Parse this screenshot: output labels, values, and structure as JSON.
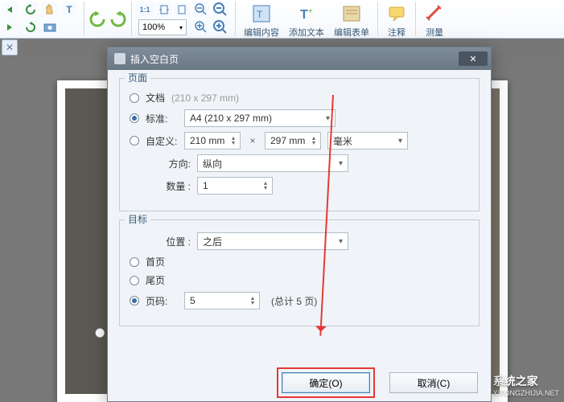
{
  "toolbar": {
    "zoom_1_1": "1:1",
    "zoom_percent": "100%",
    "edit_content": "编辑内容",
    "add_text": "添加文本",
    "edit_form": "编辑表单",
    "annotate": "注释",
    "measure": "测量"
  },
  "dialog": {
    "title": "插入空白页",
    "page_group": "页面",
    "document_label": "文档",
    "document_size": "(210 x 297 mm)",
    "standard_label": "标准:",
    "standard_value": "A4 (210 x 297 mm)",
    "custom_label": "自定义:",
    "custom_w": "210 mm",
    "custom_h": "297 mm",
    "unit_value": "毫米",
    "orientation_label": "方向:",
    "orientation_value": "纵向",
    "quantity_label": "数量 :",
    "quantity_value": "1",
    "target_group": "目标",
    "position_label": "位置 :",
    "position_value": "之后",
    "first_page_label": "首页",
    "last_page_label": "尾页",
    "page_no_label": "页码:",
    "page_no_value": "5",
    "total_pages": "(总计 5 页)",
    "ok": "确定(O)",
    "cancel": "取消(C)"
  },
  "watermark": {
    "text": "系统之家",
    "sub": "XITONGZHIJIA.NET"
  }
}
